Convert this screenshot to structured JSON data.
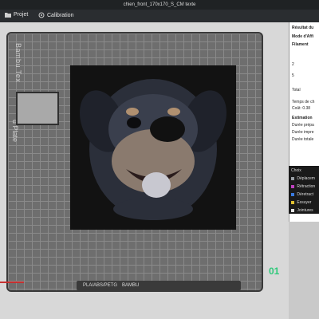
{
  "window": {
    "title": "chien_front_170x170_S_CM texte"
  },
  "menu": {
    "items": [
      {
        "label": "Projet"
      },
      {
        "label": "Calibration"
      }
    ]
  },
  "plate": {
    "brand_text": "Bambu Tex",
    "plate_text": "d Plate",
    "plate_number": "01",
    "bottom_labels": [
      "PLA/ABS/PETG",
      "BAMBU"
    ],
    "accent_number_color": "#2ec97a"
  },
  "panel": {
    "result_title": "Résultat du",
    "display_mode": "Mode d'Affi",
    "filament_label": "Filament",
    "filament_values": [
      "2",
      "5"
    ],
    "total_label": "Total",
    "time_label": "Temps de ch",
    "cost_label": "Coût:",
    "cost_value": "0.38",
    "estimation_label": "Estimation",
    "prep_label": "Durée prépa",
    "print_label": "Durée impre",
    "total_dur_label": "Durée totale",
    "choice_label": "Choix",
    "legend": [
      {
        "label": "Déplacem",
        "color": "#9aa0a6"
      },
      {
        "label": "Rétraction",
        "color": "#c040c0"
      },
      {
        "label": "Déretract",
        "color": "#3a7be0"
      },
      {
        "label": "Essuyer",
        "color": "#e0c030"
      },
      {
        "label": "Jointures",
        "color": "#e6e6e6"
      }
    ]
  }
}
